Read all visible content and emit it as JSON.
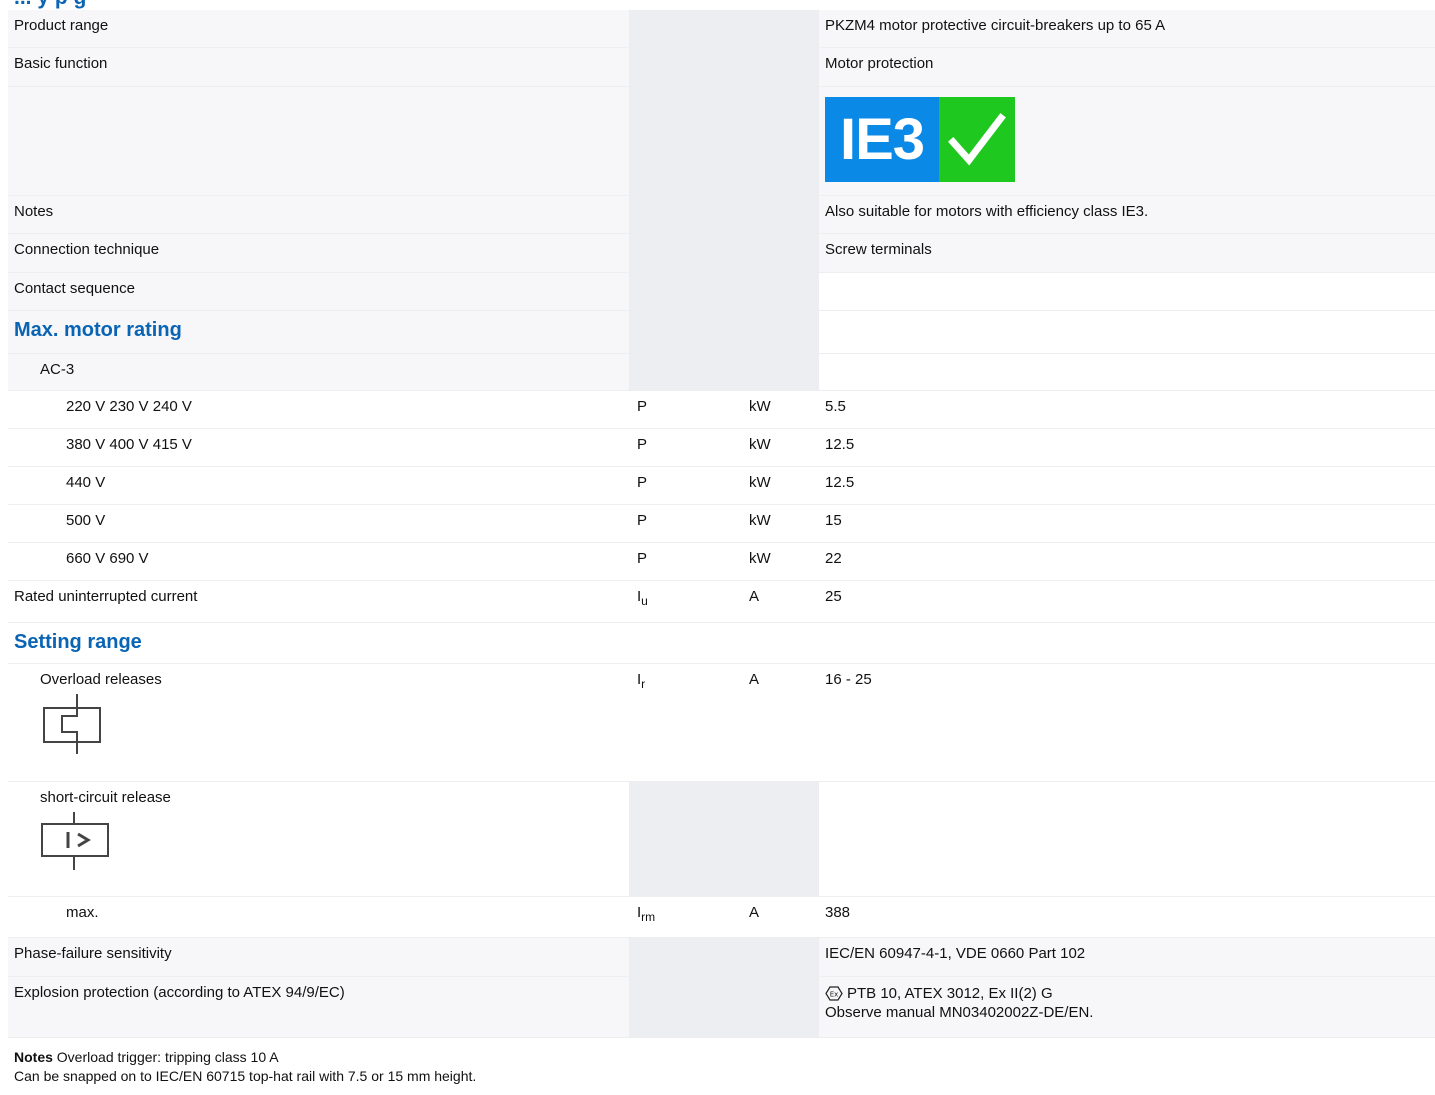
{
  "header": {
    "title_fragment": "... y p g"
  },
  "rows": [
    {
      "kind": "plain",
      "label": "Product range",
      "symbol": "",
      "unit": "",
      "value": "PKZM4 motor protective circuit-breakers up to 65 A"
    },
    {
      "kind": "plain",
      "label": "Basic function",
      "symbol": "",
      "unit": "",
      "value": "Motor protection"
    },
    {
      "kind": "badge",
      "label": "",
      "badge": {
        "text": "IE3",
        "colors": {
          "blue": "#0a8ae6",
          "green": "#1ec81e"
        }
      }
    },
    {
      "kind": "plain",
      "label": "Notes",
      "symbol": "",
      "unit": "",
      "value": "Also suitable for motors with efficiency class IE3."
    },
    {
      "kind": "plain",
      "label": "Connection technique",
      "symbol": "",
      "unit": "",
      "value": "Screw terminals"
    },
    {
      "kind": "plain",
      "label": "Contact sequence",
      "symbol": "",
      "unit": "",
      "value": ""
    },
    {
      "kind": "section",
      "label": "Max. motor rating"
    },
    {
      "kind": "plain",
      "indent": 1,
      "label": "AC-3",
      "symbol": "",
      "unit": "",
      "value": ""
    },
    {
      "kind": "data",
      "indent": 2,
      "label": "220 V 230 V 240 V",
      "symbol": "P",
      "unit": "kW",
      "value": "5.5"
    },
    {
      "kind": "data",
      "indent": 2,
      "label": "380 V 400 V 415 V",
      "symbol": "P",
      "unit": "kW",
      "value": "12.5"
    },
    {
      "kind": "data",
      "indent": 2,
      "label": "440 V",
      "symbol": "P",
      "unit": "kW",
      "value": "12.5"
    },
    {
      "kind": "data",
      "indent": 2,
      "label": "500 V",
      "symbol": "P",
      "unit": "kW",
      "value": "15"
    },
    {
      "kind": "data",
      "indent": 2,
      "label": "660 V 690 V",
      "symbol": "P",
      "unit": "kW",
      "value": "22"
    },
    {
      "kind": "data",
      "label": "Rated uninterrupted current",
      "symbol_base": "I",
      "symbol_sub": "u",
      "unit": "A",
      "value": "25"
    },
    {
      "kind": "section",
      "label": "Setting range"
    },
    {
      "kind": "data",
      "indent": 1,
      "label": "Overload releases",
      "symbol_base": "I",
      "symbol_sub": "r",
      "unit": "A",
      "value": "16 - 25",
      "icon": "overload-release-symbol-icon"
    },
    {
      "kind": "plain",
      "indent": 1,
      "label": "short-circuit release",
      "symbol": "",
      "unit": "",
      "value": "",
      "icon": "short-circuit-release-symbol-icon"
    },
    {
      "kind": "data",
      "indent": 2,
      "label": "max.",
      "symbol_base": "I",
      "symbol_sub": "rm",
      "unit": "A",
      "value": "388"
    },
    {
      "kind": "plain",
      "label": "Phase-failure sensitivity",
      "symbol": "",
      "unit": "",
      "value": "IEC/EN 60947-4-1, VDE 0660 Part 102"
    },
    {
      "kind": "plain",
      "label": "Explosion protection (according to ATEX 94/9/EC)",
      "symbol": "",
      "unit": "",
      "value": "PTB 10, ATEX 3012, Ex II(2) G",
      "value2": "Observe manual MN03402002Z-DE/EN.",
      "icon": "ex-icon"
    }
  ],
  "footer": {
    "notes_label": "Notes",
    "line1": "Overload trigger: tripping class 10 A",
    "line2": "Can be snapped on to IEC/EN 60715 top-hat rail with 7.5 or 15 mm height."
  }
}
